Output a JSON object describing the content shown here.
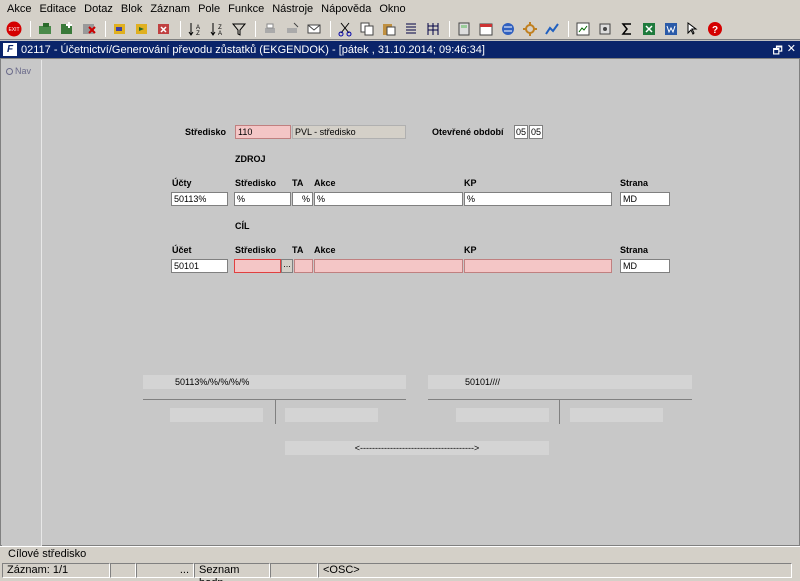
{
  "menu": [
    "Akce",
    "Editace",
    "Dotaz",
    "Blok",
    "Záznam",
    "Pole",
    "Funkce",
    "Nástroje",
    "Nápověda",
    "Okno"
  ],
  "toolbar": {
    "exit_label": "EXIT",
    "help_label": "?"
  },
  "window": {
    "logo": "F",
    "title": "02117 - Účetnictví/Generování převodu zůstatků (EKGENDOK) - [pátek  , 31.10.2014; 09:46:34]",
    "restore": "🗗",
    "close": "✕"
  },
  "nav": {
    "label": "Nav"
  },
  "form": {
    "stredisko_label": "Středisko",
    "stredisko_code": "110",
    "stredisko_name": "PVL - středisko",
    "obdobi_label": "Otevřené období",
    "obdobi_from": "05",
    "obdobi_to": "05",
    "zdroj": {
      "heading": "ZDROJ",
      "col_ucty": "Účty",
      "col_stredisko": "Středisko",
      "col_ta": "TA",
      "col_akce": "Akce",
      "col_kp": "KP",
      "col_strana": "Strana",
      "val_ucty": "50113%",
      "val_stredisko": "%",
      "val_ta": "%",
      "val_akce": "%",
      "val_kp": "%",
      "val_strana": "MD"
    },
    "cil": {
      "heading": "CÍL",
      "col_ucet": "Účet",
      "col_stredisko": "Středisko",
      "col_ta": "TA",
      "col_akce": "Akce",
      "col_kp": "KP",
      "col_strana": "Strana",
      "val_ucet": "50101",
      "val_stredisko": "",
      "lov_button": "...",
      "val_ta": "",
      "val_akce": "",
      "val_kp": "",
      "val_strana": "MD"
    }
  },
  "summary": {
    "source": "50113%/%/%/%/%",
    "target": "50101////",
    "arrow": "<-------------------------------------->"
  },
  "statusbar": {
    "hint": "Cílové středisko",
    "record": "Záznam: 1/1",
    "cell2": "",
    "cell3": "...",
    "list": "Seznam hodn...",
    "cell5": "",
    "mode": "<OSC>"
  }
}
